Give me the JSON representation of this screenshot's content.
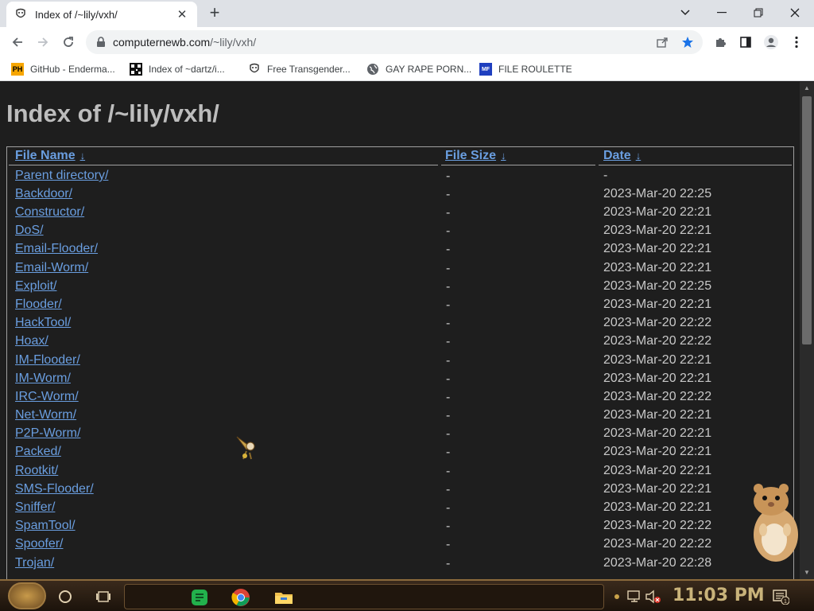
{
  "browser": {
    "tab_title": "Index of /~lily/vxh/",
    "url_domain": "computernewb.com",
    "url_path": "/~lily/vxh/",
    "bookmarks": [
      {
        "label": "GitHub - Enderma...",
        "icon": "ph-icon"
      },
      {
        "label": "Index of ~dartz/i...",
        "icon": "qr-icon"
      },
      {
        "label": "Free Transgender...",
        "icon": "mask-icon"
      },
      {
        "label": "GAY RAPE PORN...",
        "icon": "globe-icon"
      },
      {
        "label": "FILE ROULETTE",
        "icon": "mft-icon"
      }
    ]
  },
  "page": {
    "heading": "Index of /~lily/vxh/",
    "columns": {
      "name": "File Name",
      "size": "File Size",
      "date": "Date",
      "sort_arrow": "↓"
    },
    "rows": [
      {
        "name": "Parent directory/",
        "size": "-",
        "date": "-"
      },
      {
        "name": "Backdoor/",
        "size": "-",
        "date": "2023-Mar-20 22:25"
      },
      {
        "name": "Constructor/",
        "size": "-",
        "date": "2023-Mar-20 22:21"
      },
      {
        "name": "DoS/",
        "size": "-",
        "date": "2023-Mar-20 22:21"
      },
      {
        "name": "Email-Flooder/",
        "size": "-",
        "date": "2023-Mar-20 22:21"
      },
      {
        "name": "Email-Worm/",
        "size": "-",
        "date": "2023-Mar-20 22:21"
      },
      {
        "name": "Exploit/",
        "size": "-",
        "date": "2023-Mar-20 22:25"
      },
      {
        "name": "Flooder/",
        "size": "-",
        "date": "2023-Mar-20 22:21"
      },
      {
        "name": "HackTool/",
        "size": "-",
        "date": "2023-Mar-20 22:22"
      },
      {
        "name": "Hoax/",
        "size": "-",
        "date": "2023-Mar-20 22:22"
      },
      {
        "name": "IM-Flooder/",
        "size": "-",
        "date": "2023-Mar-20 22:21"
      },
      {
        "name": "IM-Worm/",
        "size": "-",
        "date": "2023-Mar-20 22:21"
      },
      {
        "name": "IRC-Worm/",
        "size": "-",
        "date": "2023-Mar-20 22:22"
      },
      {
        "name": "Net-Worm/",
        "size": "-",
        "date": "2023-Mar-20 22:21"
      },
      {
        "name": "P2P-Worm/",
        "size": "-",
        "date": "2023-Mar-20 22:21"
      },
      {
        "name": "Packed/",
        "size": "-",
        "date": "2023-Mar-20 22:21"
      },
      {
        "name": "Rootkit/",
        "size": "-",
        "date": "2023-Mar-20 22:21"
      },
      {
        "name": "SMS-Flooder/",
        "size": "-",
        "date": "2023-Mar-20 22:21"
      },
      {
        "name": "Sniffer/",
        "size": "-",
        "date": "2023-Mar-20 22:21"
      },
      {
        "name": "SpamTool/",
        "size": "-",
        "date": "2023-Mar-20 22:22"
      },
      {
        "name": "Spoofer/",
        "size": "-",
        "date": "2023-Mar-20 22:22"
      },
      {
        "name": "Trojan/",
        "size": "-",
        "date": "2023-Mar-20 22:28"
      }
    ]
  },
  "taskbar": {
    "clock": "11:03 PM",
    "notification_count": "1"
  },
  "colors": {
    "link": "#6a9ee0",
    "page_bg": "#1e1e1e",
    "heading": "#bdbdbd"
  }
}
